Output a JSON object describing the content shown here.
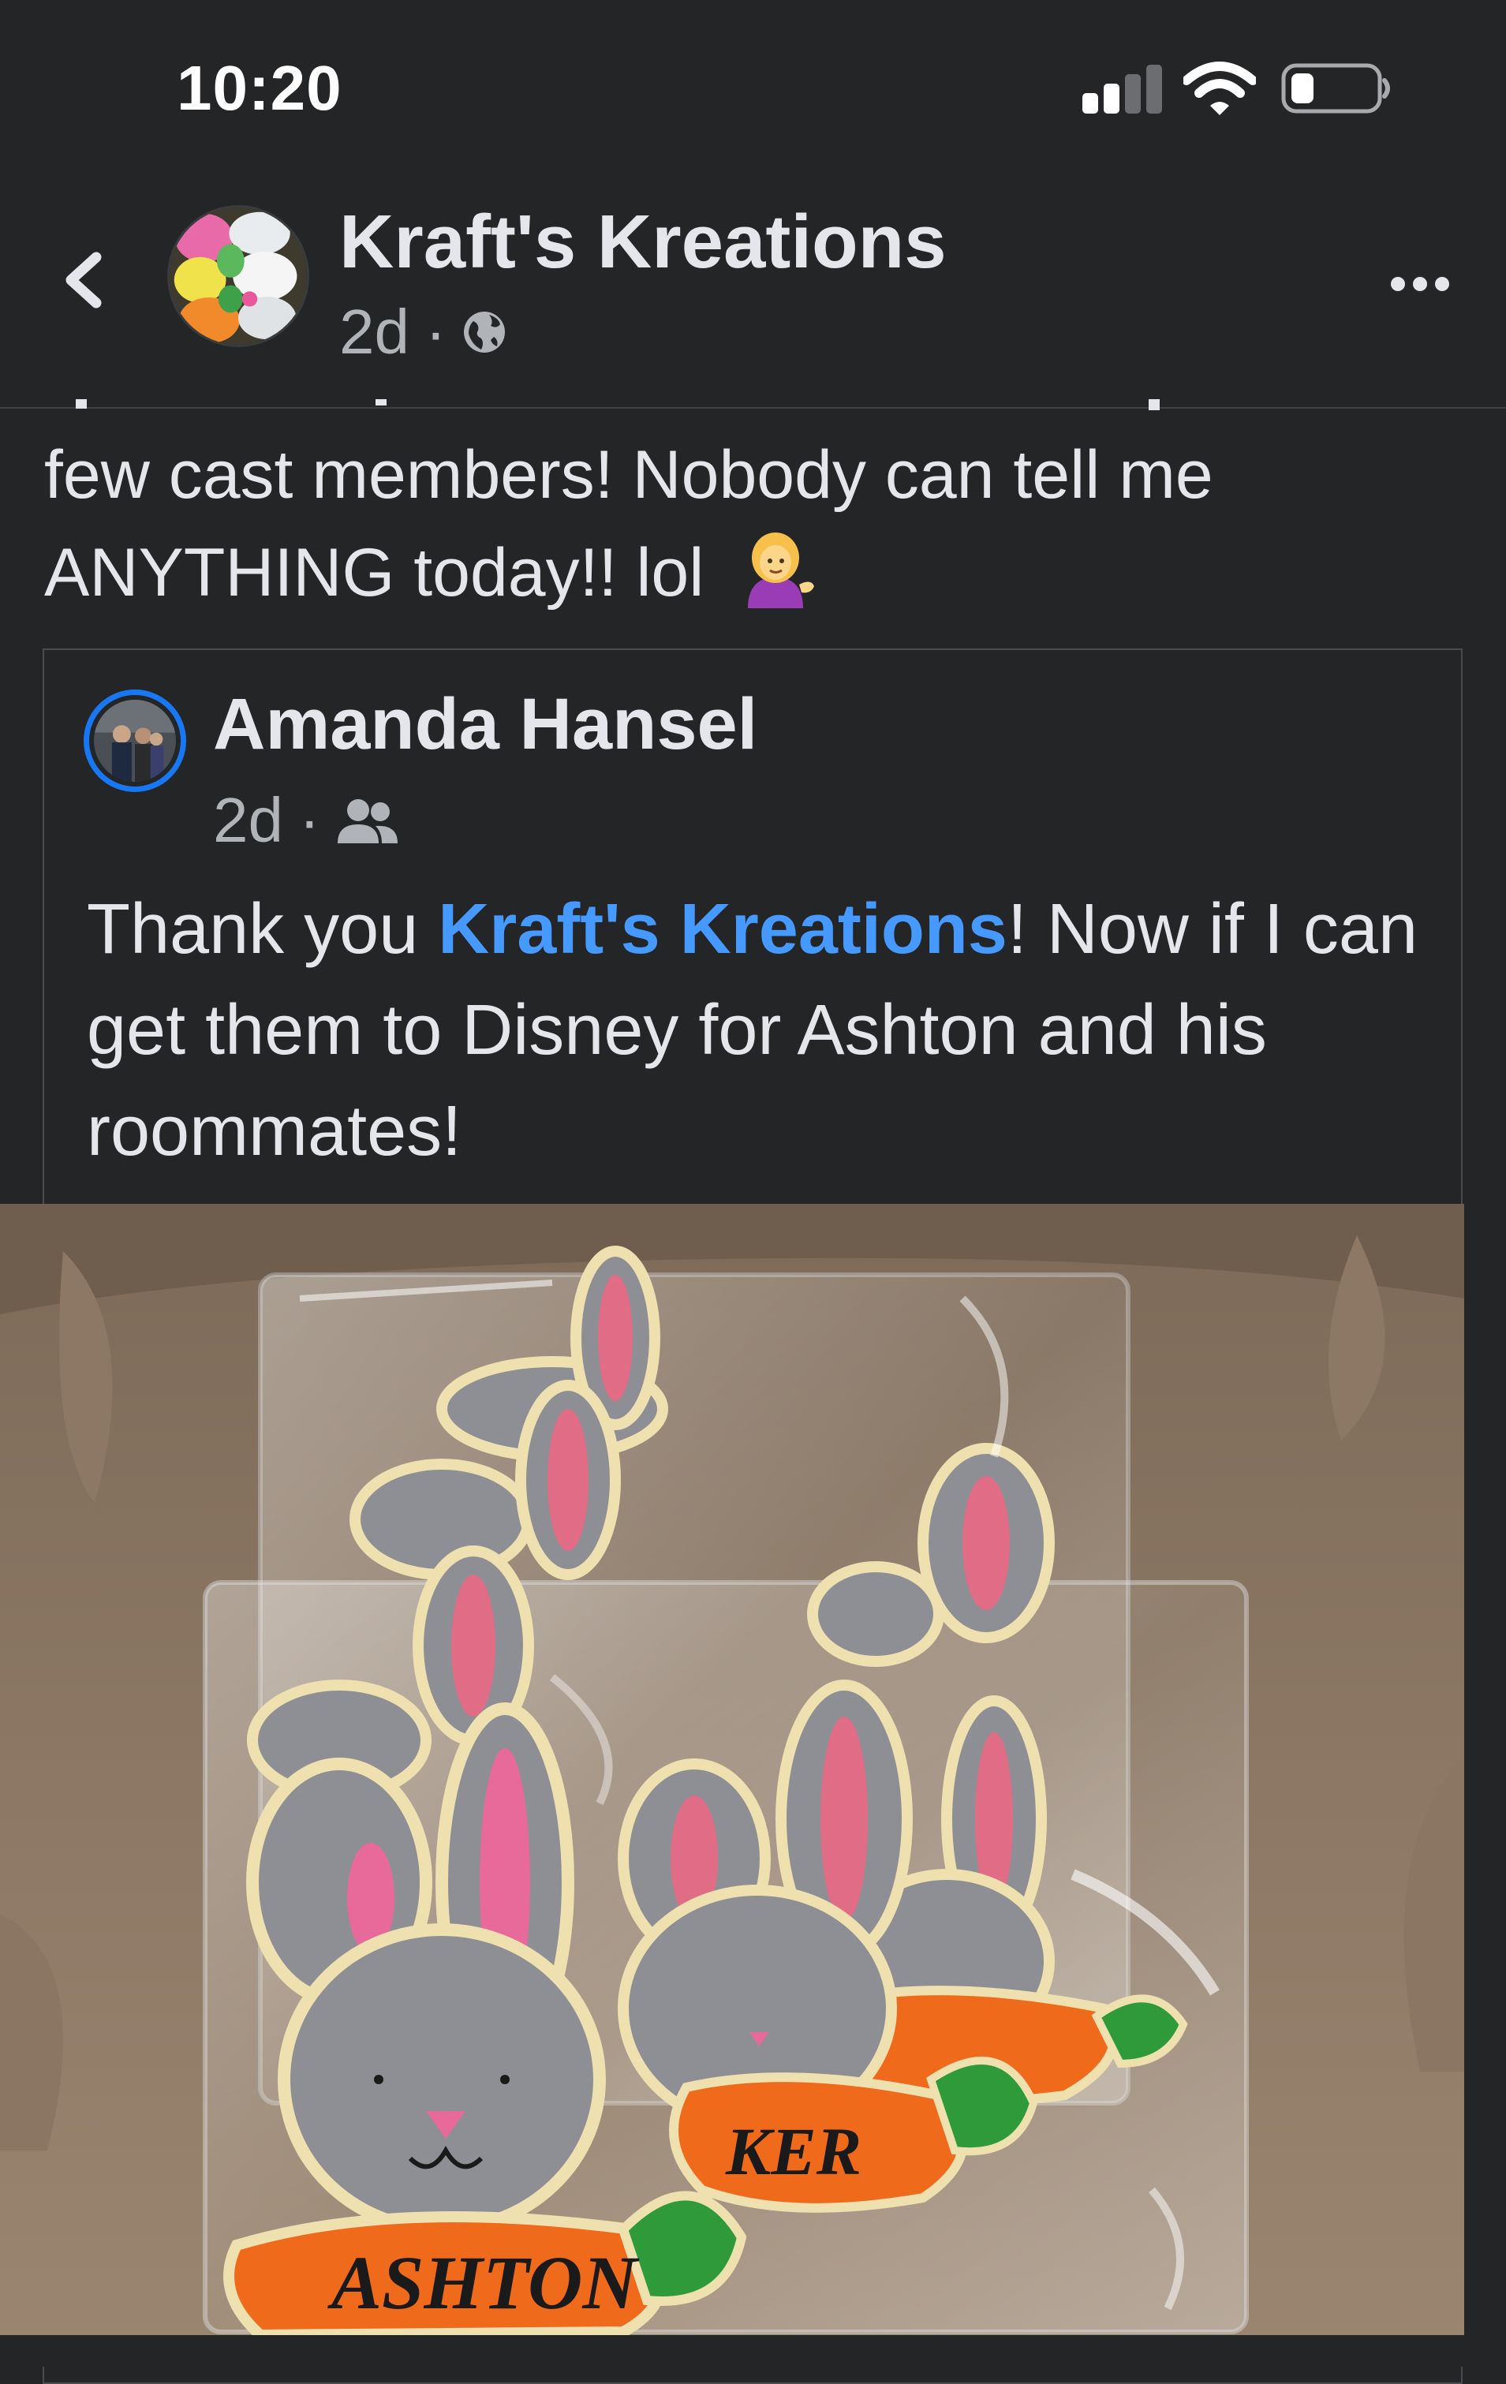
{
  "status_bar": {
    "time": "10:20",
    "signal_icon": "cellular-signal-icon",
    "wifi_icon": "wifi-icon",
    "battery_icon": "battery-icon"
  },
  "header": {
    "back_icon": "chevron-left-icon",
    "page_name": "Kraft's Kreations",
    "age": "2d",
    "separator": "·",
    "privacy_icon": "globe-icon",
    "more_icon": "more-horizontal-icon"
  },
  "post": {
    "text_line1": "few cast members! Nobody can tell me",
    "text_line2": "ANYTHING today!! lol",
    "emoji_icon": "woman-tipping-hand-emoji"
  },
  "shared_comment": {
    "author": "Amanda Hansel",
    "age": "2d",
    "separator": "·",
    "audience_icon": "friends-icon",
    "text_before": "Thank you ",
    "mention": "Kraft's Kreations",
    "text_after": "! Now if I can get them to Disney for Ashton and his roommates!"
  },
  "photo": {
    "cookie_label_front": "ASHTON",
    "cookie_label_middle": "KER"
  },
  "colors": {
    "background": "#242526",
    "text_primary": "#e4e6eb",
    "text_secondary": "#b0b3b8",
    "mention": "#4599ff",
    "avatar_ring": "#1877f2"
  }
}
